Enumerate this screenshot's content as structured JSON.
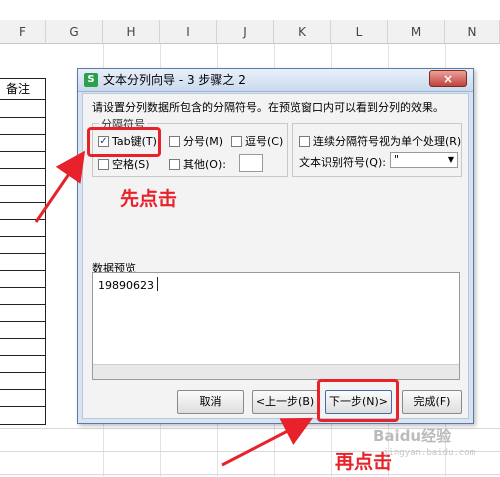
{
  "spreadsheet": {
    "columns": [
      "F",
      "G",
      "H",
      "I",
      "J",
      "K",
      "L",
      "M",
      "N"
    ],
    "cell_header_text": "备注"
  },
  "dialog": {
    "title": "文本分列向导 - 3 步骤之 2",
    "app_icon_letter": "S",
    "close_label": "×",
    "instruction": "请设置分列数据所包含的分隔符号。在预览窗口内可以看到分列的效果。",
    "delimiters": {
      "group_title": "分隔符号",
      "tab": {
        "label": "Tab键(T)",
        "checked": true
      },
      "semicolon": {
        "label": "分号(M)",
        "checked": false
      },
      "comma": {
        "label": "逗号(C)",
        "checked": false
      },
      "space": {
        "label": "空格(S)",
        "checked": false
      },
      "other": {
        "label": "其他(O):",
        "checked": false,
        "value": ""
      }
    },
    "consecutive": {
      "label": "连续分隔符号视为单个处理(R)",
      "checked": false
    },
    "text_qualifier": {
      "label": "文本识别符号(Q):",
      "value": "\"",
      "arrow": "▼"
    },
    "preview": {
      "label": "数据预览",
      "rows": [
        "19890623"
      ]
    },
    "buttons": {
      "cancel": "取消",
      "back": "<上一步(B)",
      "next": "下一步(N)>",
      "finish": "完成(F)"
    }
  },
  "annotations": {
    "first_click": "先点击",
    "second_click": "再点击",
    "color": "#e8222a"
  },
  "watermark": {
    "text": "Baidu经验",
    "sub": "jingyan.baidu.com"
  }
}
